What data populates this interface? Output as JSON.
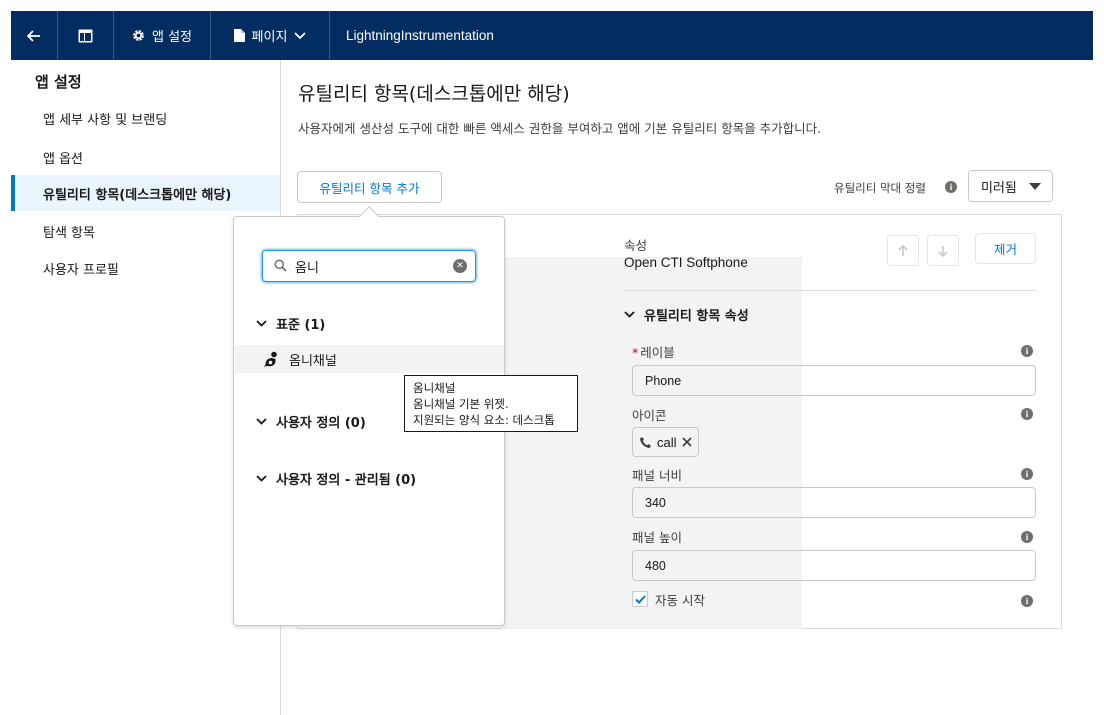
{
  "topbar": {
    "settings_label": "앱 설정",
    "page_label": "페이지",
    "title": "LightningInstrumentation"
  },
  "sidebar": {
    "heading": "앱 설정",
    "items": [
      {
        "label": "앱 세부 사항 및 브랜딩"
      },
      {
        "label": "앱 옵션"
      },
      {
        "label": "유틸리티 항목(데스크톱에만 해당)"
      },
      {
        "label": "탐색 항목"
      },
      {
        "label": "사용자 프로필"
      }
    ]
  },
  "main": {
    "title": "유틸리티 항목(데스크톱에만 해당)",
    "description": "사용자에게 생산성 도구에 대한 빠른 액세스 권한을 부여하고 앱에 기본 유틸리티 항목을 추가합니다.",
    "add_button": "유틸리티 항목 추가",
    "align_label": "유틸리티 막대 정렬",
    "align_value": "미러됨"
  },
  "properties": {
    "caption": "속성",
    "item_name": "Open CTI Softphone",
    "remove_button": "제거",
    "section_title": "유틸리티 항목 속성",
    "label_field": {
      "label": "레이블",
      "value": "Phone"
    },
    "icon_field": {
      "label": "아이콘",
      "value": "call"
    },
    "width_field": {
      "label": "패널 너비",
      "value": "340"
    },
    "height_field": {
      "label": "패널 높이",
      "value": "480"
    },
    "autostart": {
      "label": "자동 시작",
      "checked": true
    }
  },
  "popover": {
    "search_value": "옴니",
    "groups": [
      {
        "label": "표준 (1)"
      },
      {
        "label": "사용자 정의 (0)"
      },
      {
        "label": "사용자 정의 - 관리됨 (0)"
      }
    ],
    "result_label": "옴니채널"
  },
  "tooltip": {
    "line1": "옴니채널",
    "line2": "옴니채널 기본 위젯.",
    "line3": "지원되는 양식 요소: 데스크톱"
  },
  "colors": {
    "header_bg": "#032d60",
    "brand_blue": "#0176d3",
    "active_bg": "#eaf5fe"
  }
}
